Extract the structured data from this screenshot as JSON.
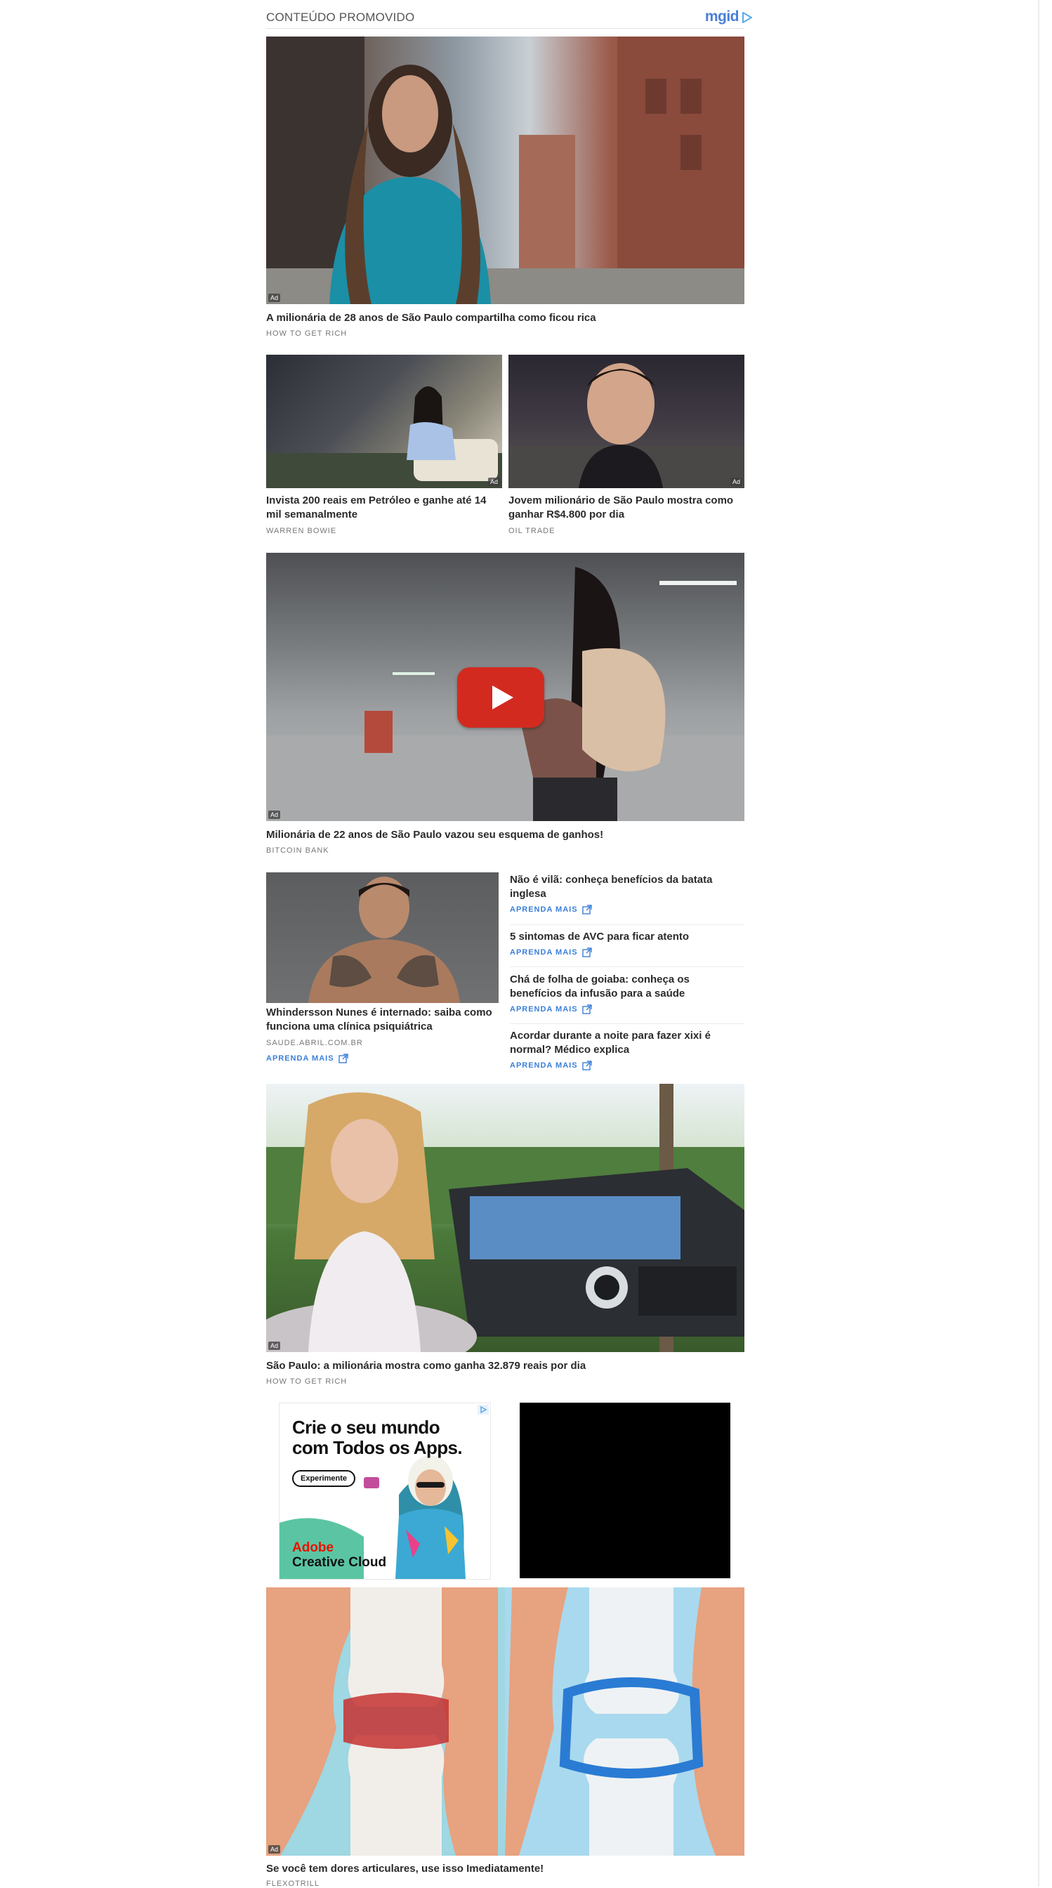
{
  "header": {
    "title": "CONTEÚDO PROMOVIDO",
    "brand": "mgid"
  },
  "ad_badge": "Ad",
  "cards": [
    {
      "title": "A milionária de 28 anos de São Paulo compartilha como ficou rica",
      "source": "HOW TO GET RICH"
    },
    {
      "title": "Invista 200 reais em Petróleo e ganhe até 14 mil semanalmente",
      "source": "WARREN BOWIE"
    },
    {
      "title": "Jovem milionário de São Paulo mostra como ganhar R$4.800 por dia",
      "source": "OIL TRADE"
    },
    {
      "title": "Milionária de 22 anos de São Paulo vazou seu esquema de ganhos!",
      "source": "BITCOIN BANK"
    },
    {
      "title": "Whindersson Nunes é internado: saiba como funciona uma clínica psiquiátrica",
      "source": "SAUDE.ABRIL.COM.BR",
      "cta": "APRENDA MAIS"
    },
    {
      "title": "São Paulo: a milionária mostra como ganha 32.879 reais por dia",
      "source": "HOW TO GET RICH"
    },
    {
      "title": "Se você tem dores articulares, use isso Imediatamente!",
      "source": "FLEXOTRILL"
    }
  ],
  "side_list": [
    {
      "title": "Não é vilã: conheça benefícios da batata inglesa",
      "cta": "APRENDA MAIS"
    },
    {
      "title": "5 sintomas de AVC para ficar atento",
      "cta": "APRENDA MAIS"
    },
    {
      "title": "Chá de folha de goiaba: conheça os benefícios da infusão para a saúde",
      "cta": "APRENDA MAIS"
    },
    {
      "title": "Acordar durante a noite para fazer xixi é normal? Médico explica",
      "cta": "APRENDA MAIS"
    }
  ],
  "adobe_banner": {
    "headline": "Crie o seu mundo com Todos os Apps.",
    "button": "Experimente",
    "brand_line1": "Adobe",
    "brand_line2": "Creative Cloud"
  },
  "colors": {
    "accent": "#3a7fd9",
    "adobe_red": "#eb1000",
    "youtube_red": "#e62117"
  }
}
